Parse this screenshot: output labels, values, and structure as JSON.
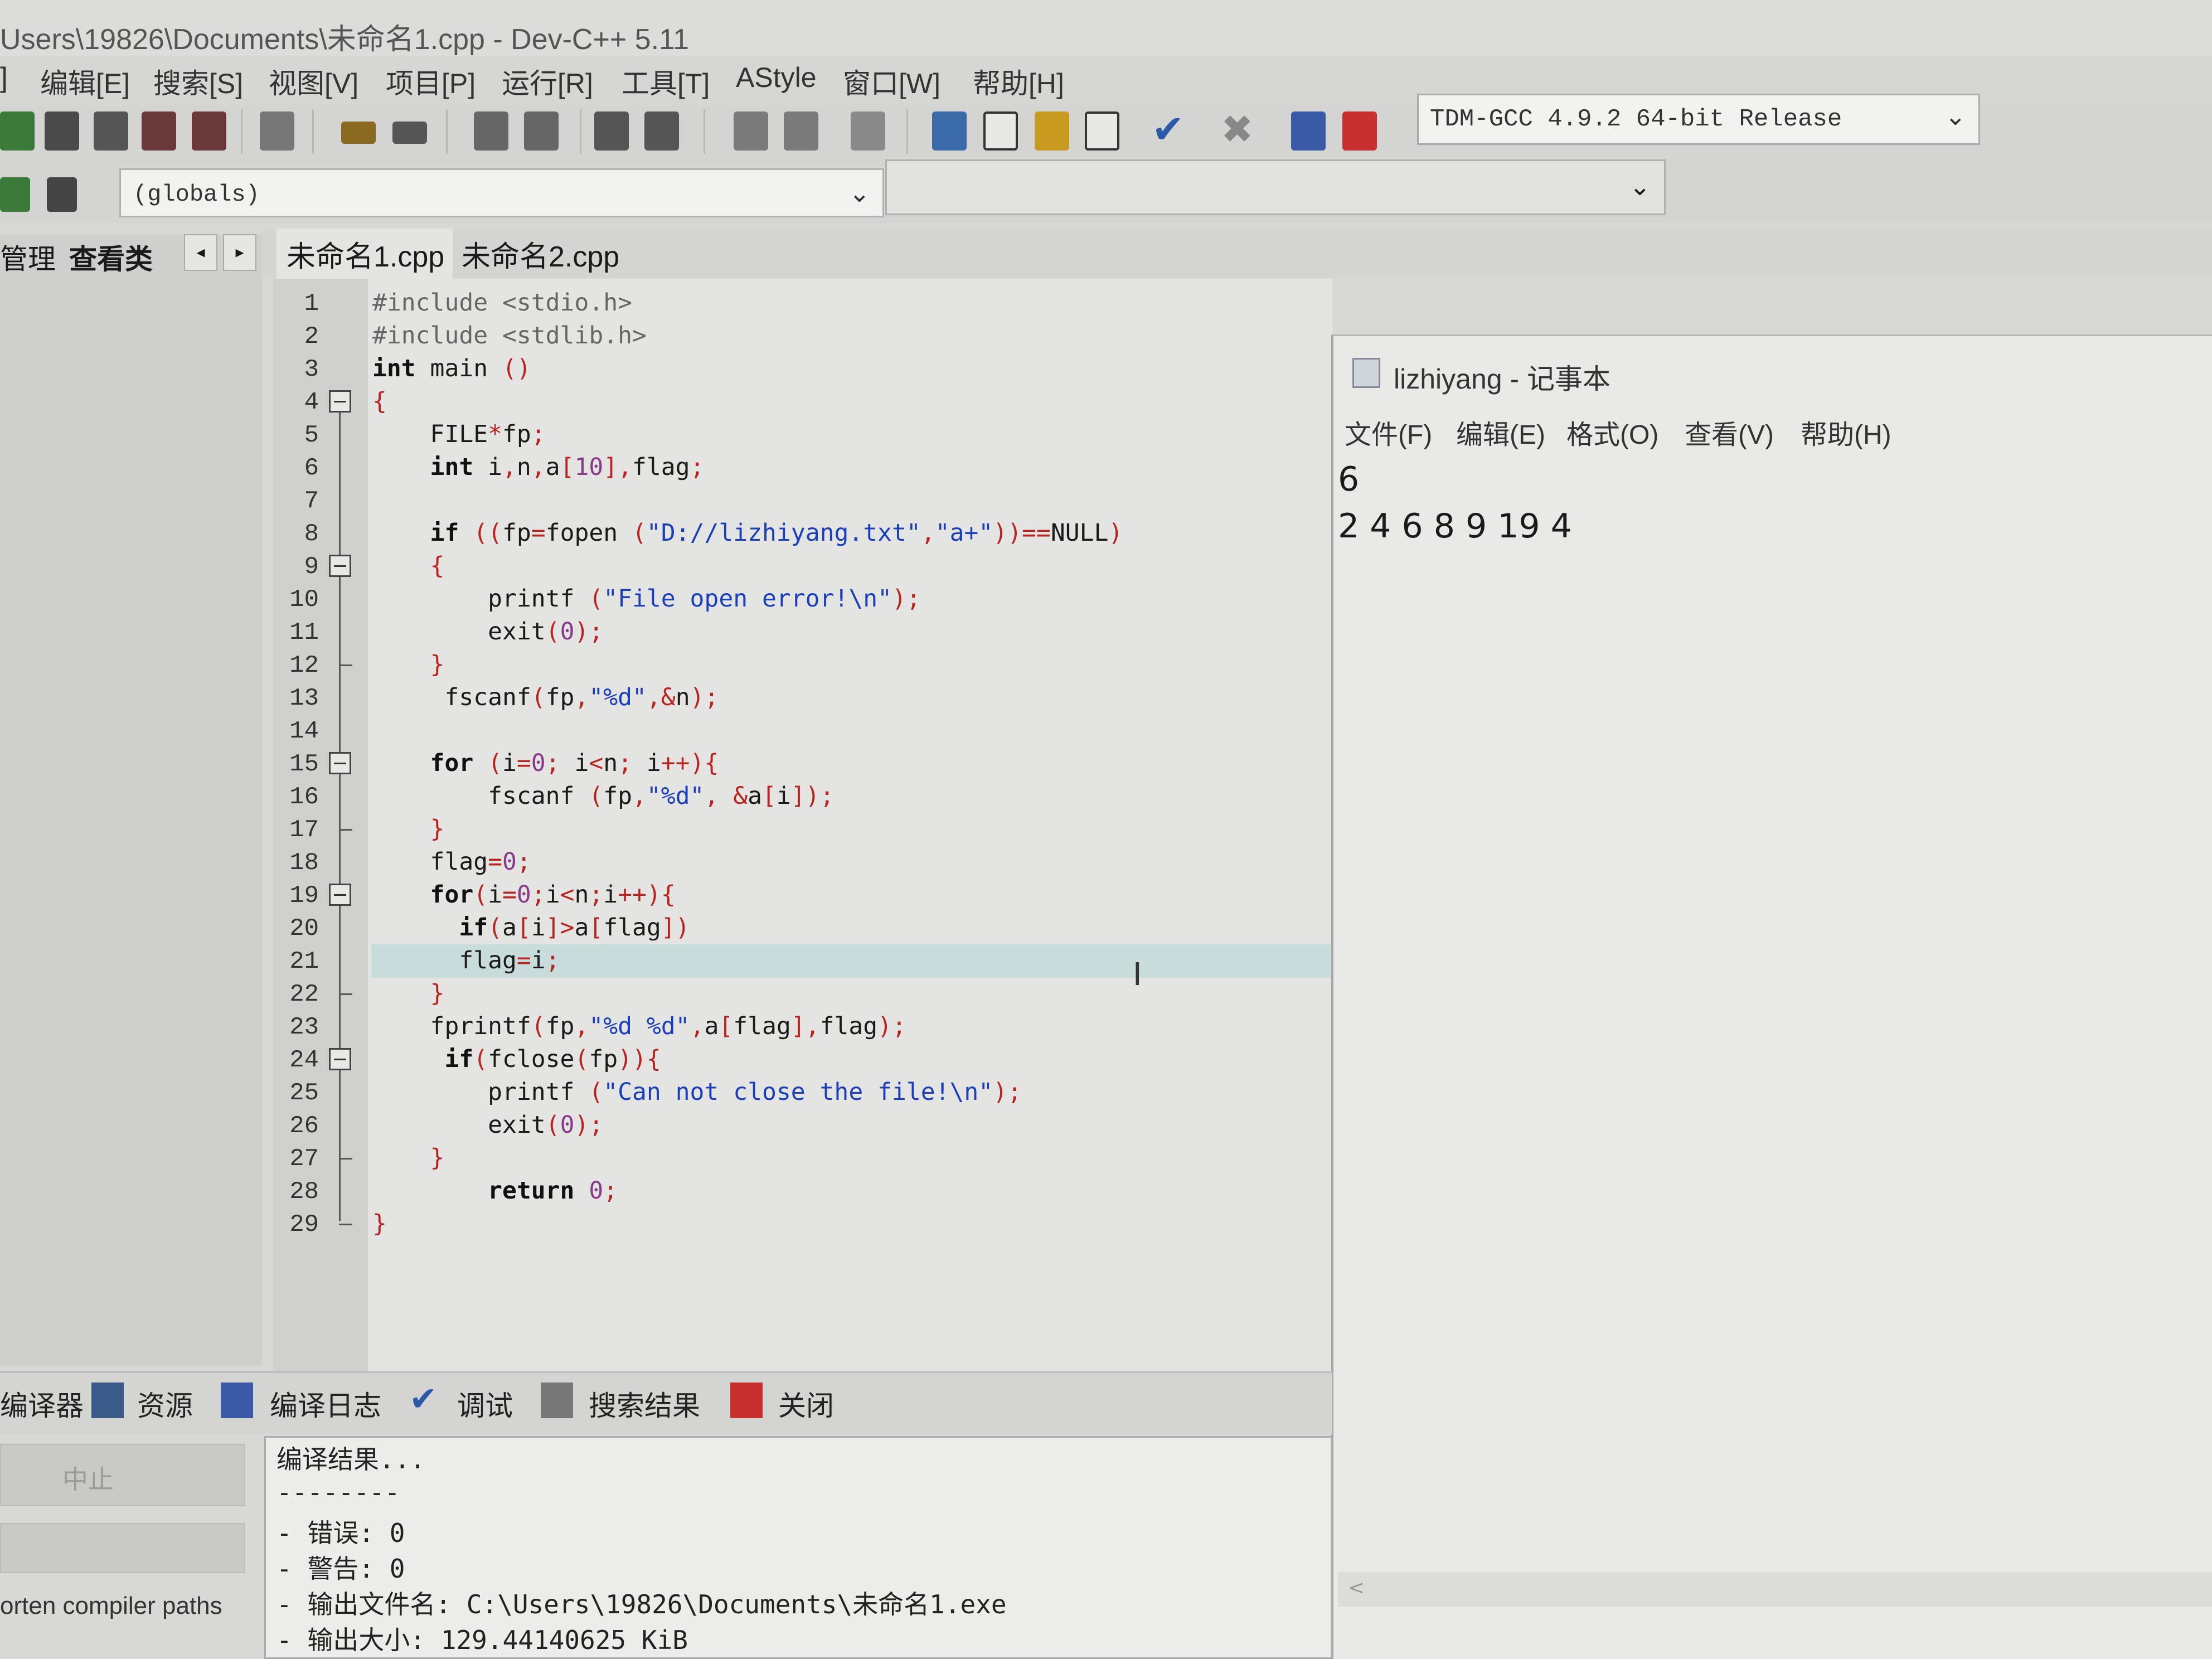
{
  "window": {
    "title": "Users\\19826\\Documents\\未命名1.cpp - Dev-C++ 5.11"
  },
  "menu": [
    {
      "label": "]"
    },
    {
      "label": "编辑[E]"
    },
    {
      "label": "搜索[S]"
    },
    {
      "label": "视图[V]"
    },
    {
      "label": "项目[P]"
    },
    {
      "label": "运行[R]"
    },
    {
      "label": "工具[T]"
    },
    {
      "label": "AStyle"
    },
    {
      "label": "窗口[W]"
    },
    {
      "label": "帮助[H]"
    }
  ],
  "toolbar": {
    "compiler": "TDM-GCC 4.9.2 64-bit Release",
    "chevron": "⌄"
  },
  "scope": {
    "globals": "(globals)"
  },
  "left_panel": {
    "tabs": [
      "管理",
      "查看类"
    ],
    "arrow_left": "◂",
    "arrow_right": "▸"
  },
  "editor": {
    "tabs": [
      "未命名1.cpp",
      "未命名2.cpp"
    ],
    "line_numbers": [
      "1",
      "2",
      "3",
      "4",
      "5",
      "6",
      "7",
      "8",
      "9",
      "10",
      "11",
      "12",
      "13",
      "14",
      "15",
      "16",
      "17",
      "18",
      "19",
      "20",
      "21",
      "22",
      "23",
      "24",
      "25",
      "26",
      "27",
      "28",
      "29"
    ],
    "code": {
      "l1": "#include <stdio.h>",
      "l2": "#include <stdlib.h>",
      "l3a": "int",
      "l3b": " main ",
      "l3c": "()",
      "l4": "{",
      "l5a": "    FILE",
      "l5b": "*",
      "l5c": "fp",
      "l5d": ";",
      "l6a": "    int",
      "l6b": " i",
      "l6c": ",",
      "l6d": "n",
      "l6e": ",",
      "l6f": "a",
      "l6g": "[",
      "l6h": "10",
      "l6i": "],",
      "l6j": "flag",
      "l6k": ";",
      "l8a": "    if",
      "l8b": " ((",
      "l8c": "fp",
      "l8d": "=",
      "l8e": "fopen ",
      "l8f": "(",
      "l8g": "\"D://lizhiyang.txt\"",
      "l8h": ",",
      "l8i": "\"a+\"",
      "l8j": "))==",
      "l8k": "NULL",
      "l8l": ")",
      "l9": "    {",
      "l10a": "        printf ",
      "l10b": "(",
      "l10c": "\"File open error!\\n\"",
      "l10d": ");",
      "l11a": "        exit",
      "l11b": "(",
      "l11c": "0",
      "l11d": ");",
      "l12": "    }",
      "l13a": "     fscanf",
      "l13b": "(",
      "l13c": "fp",
      "l13d": ",",
      "l13e": "\"%d\"",
      "l13f": ",&",
      "l13g": "n",
      "l13h": ");",
      "l15a": "    for",
      "l15b": " (",
      "l15c": "i",
      "l15d": "=",
      "l15e": "0",
      "l15f": "; ",
      "l15g": "i",
      "l15h": "<",
      "l15i": "n",
      "l15j": "; ",
      "l15k": "i",
      "l15l": "++){",
      "l16a": "        fscanf ",
      "l16b": "(",
      "l16c": "fp",
      "l16d": ",",
      "l16e": "\"%d\"",
      "l16f": ", &",
      "l16g": "a",
      "l16h": "[",
      "l16i": "i",
      "l16j": "]);",
      "l17": "    }",
      "l18a": "    flag",
      "l18b": "=",
      "l18c": "0",
      "l18d": ";",
      "l19a": "    for",
      "l19b": "(",
      "l19c": "i",
      "l19d": "=",
      "l19e": "0",
      "l19f": ";",
      "l19g": "i",
      "l19h": "<",
      "l19i": "n",
      "l19j": ";",
      "l19k": "i",
      "l19l": "++){",
      "l20a": "      if",
      "l20b": "(",
      "l20c": "a",
      "l20d": "[",
      "l20e": "i",
      "l20f": "]>",
      "l20g": "a",
      "l20h": "[",
      "l20i": "flag",
      "l20j": "])",
      "l21a": "      flag",
      "l21b": "=",
      "l21c": "i",
      "l21d": ";",
      "l22": "    }",
      "l23a": "    fprintf",
      "l23b": "(",
      "l23c": "fp",
      "l23d": ",",
      "l23e": "\"%d %d\"",
      "l23f": ",",
      "l23g": "a",
      "l23h": "[",
      "l23i": "flag",
      "l23j": "],",
      "l23k": "flag",
      "l23l": ");",
      "l24a": "     if",
      "l24b": "(",
      "l24c": "fclose",
      "l24d": "(",
      "l24e": "fp",
      "l24f": ")){",
      "l25a": "        printf ",
      "l25b": "(",
      "l25c": "\"Can not close the file!\\n\"",
      "l25d": ");",
      "l26a": "        exit",
      "l26b": "(",
      "l26c": "0",
      "l26d": ");",
      "l27": "    }",
      "l28a": "        return ",
      "l28b": "0",
      "l28c": ";",
      "l29": "}"
    }
  },
  "notepad": {
    "title": "lizhiyang - 记事本",
    "menu": [
      "文件(F)",
      "编辑(E)",
      "格式(O)",
      "查看(V)",
      "帮助(H)"
    ],
    "content_line1": "6",
    "content_line2": "2 4 6 8 9 19 4",
    "scroll_left": "<"
  },
  "bottom_panel": {
    "tabs": [
      "编译器",
      "资源",
      "编译日志",
      "调试",
      "搜索结果",
      "关闭"
    ],
    "stop_button": "中止",
    "shorten_paths": "orten compiler paths",
    "output": [
      "编译结果...",
      "--------",
      "- 错误: 0",
      "- 警告: 0",
      "- 输出文件名: C:\\Users\\19826\\Documents\\未命名1.exe",
      "- 输出大小: 129.44140625 KiB"
    ]
  },
  "colors": {
    "keyword": "#111111",
    "string": "#1a3fb8",
    "number": "#8a3a8a",
    "symbol": "#b8241f",
    "highlight_line": "#c8dcdb"
  }
}
